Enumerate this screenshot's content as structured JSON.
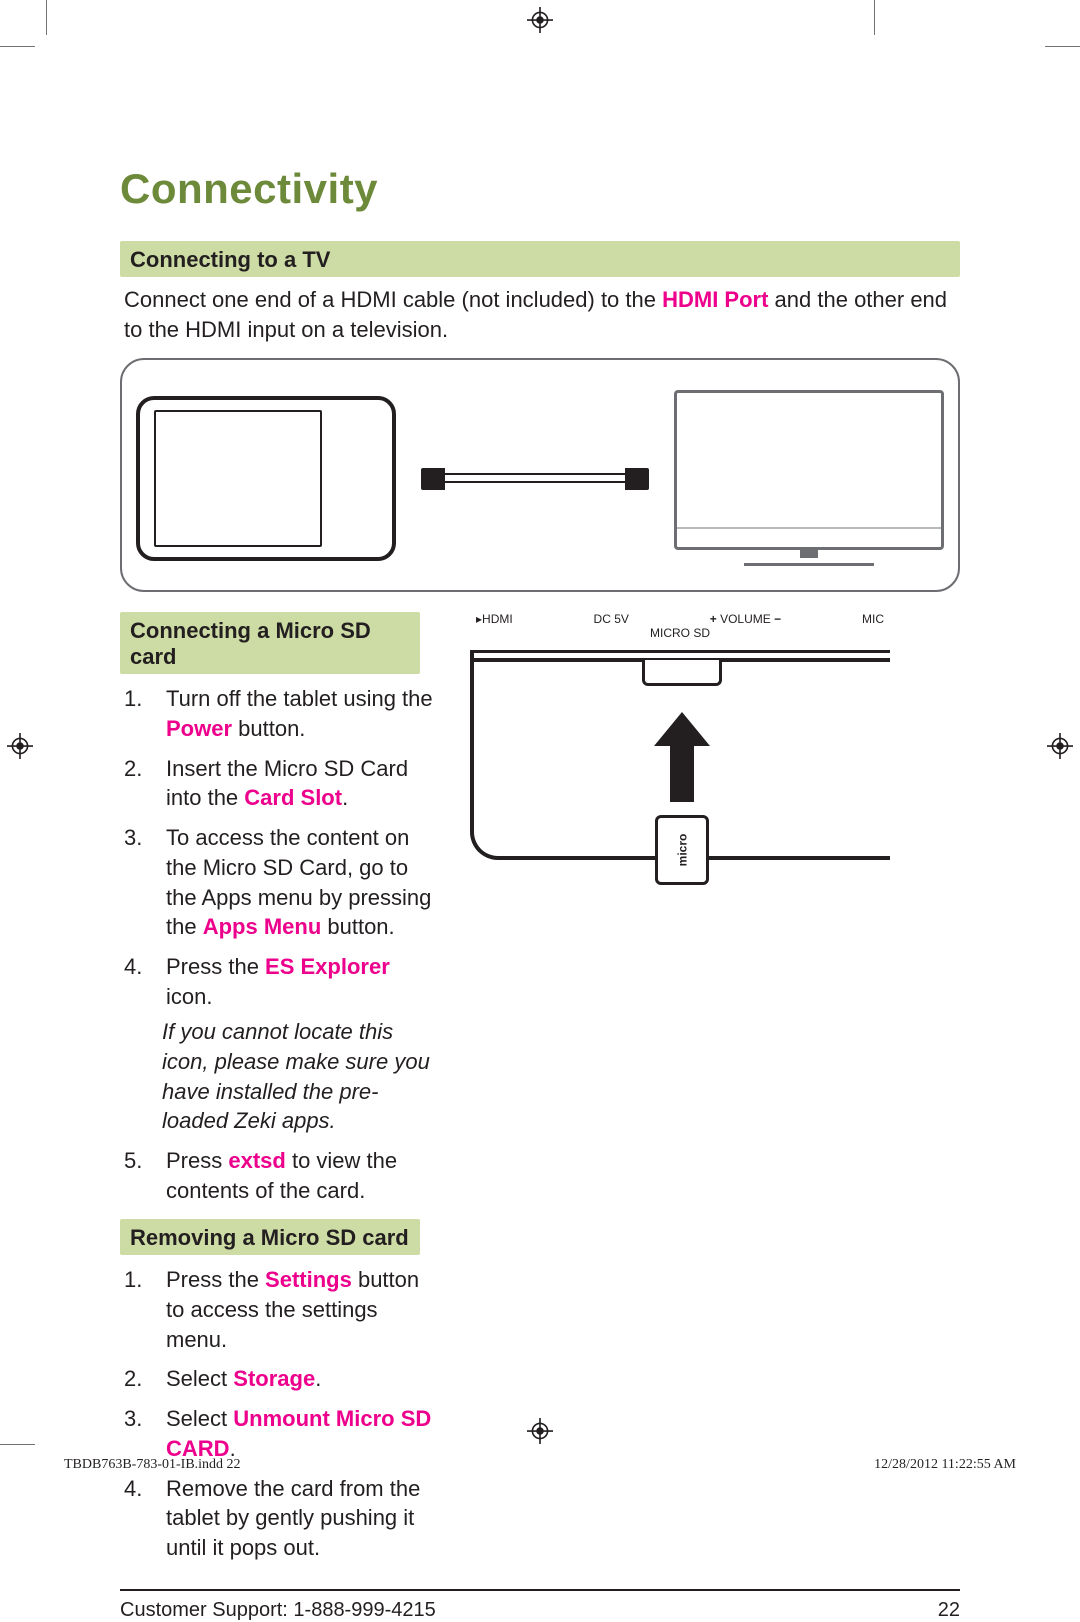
{
  "title": "Connectivity",
  "section_tv": {
    "heading": "Connecting to a TV",
    "intro_pre": "Connect one end of a HDMI cable (not included) to the ",
    "intro_hl": "HDMI Port",
    "intro_post": " and the other end to the HDMI input on a television."
  },
  "section_sd_connect": {
    "heading": "Connecting a Micro SD card",
    "steps": {
      "s1_pre": "Turn off the tablet using the ",
      "s1_hl": "Power",
      "s1_post": " button.",
      "s2_pre": "Insert the Micro SD Card into the ",
      "s2_hl": "Card Slot",
      "s2_post": ".",
      "s3_pre": "To access the content on the Micro SD Card, go to the Apps menu by pressing the ",
      "s3_hl": "Apps Menu",
      "s3_post": " button.",
      "s4_pre": "Press the ",
      "s4_hl": "ES Explorer",
      "s4_post": " icon.",
      "note": "If you cannot locate this icon, please make sure you have installed the pre-loaded Zeki apps.",
      "s5_pre": "Press ",
      "s5_hl": "extsd",
      "s5_post": " to view the contents of the card."
    }
  },
  "section_sd_remove": {
    "heading": "Removing a Micro SD card",
    "steps": {
      "s1_pre": "Press the ",
      "s1_hl": "Settings",
      "s1_post": " button to access the settings menu.",
      "s2_pre": "Select ",
      "s2_hl": "Storage",
      "s2_post": ".",
      "s3_pre": "Select ",
      "s3_hl": "Unmount Micro SD CARD",
      "s3_post": ".",
      "s4": "Remove the card from the tablet by gently pushing it until it pops out."
    }
  },
  "sd_diagram": {
    "label_hdmi": "HDMI",
    "label_dc": "DC 5V",
    "label_vol": "VOLUME",
    "label_plus": "+",
    "label_minus": "−",
    "label_mic": "MIC",
    "label_slot": "MICRO SD",
    "card_text": "micro"
  },
  "footer": {
    "support": "Customer Support: 1-888-999-4215",
    "page": "22"
  },
  "print_footer": {
    "file": "TBDB763B-783-01-IB.indd   22",
    "stamp": "12/28/2012   11:22:55 AM"
  }
}
